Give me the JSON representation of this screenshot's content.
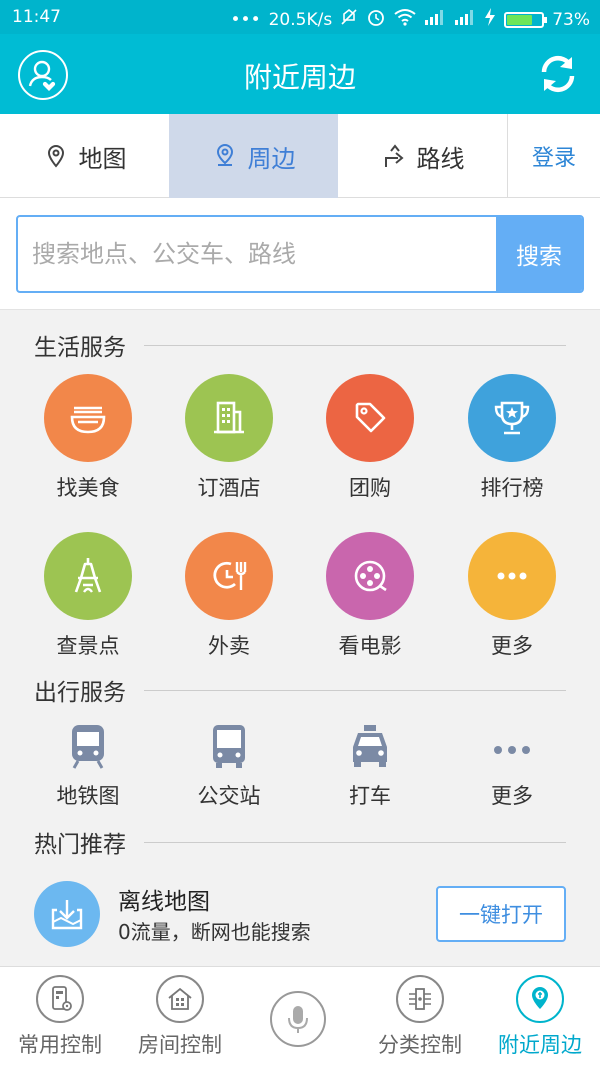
{
  "status_bar": {
    "time": "11:47",
    "network_speed": "20.5K/s",
    "battery_level": "73%",
    "battery_fraction": 0.73
  },
  "header": {
    "title": "附近周边"
  },
  "tabs": [
    {
      "label": "地图",
      "icon": "map-pin-icon"
    },
    {
      "label": "周边",
      "icon": "location-icon",
      "active": true
    },
    {
      "label": "路线",
      "icon": "route-icon"
    }
  ],
  "login_label": "登录",
  "search": {
    "placeholder": "搜索地点、公交车、路线",
    "value": "",
    "button_label": "搜索"
  },
  "life_services": {
    "title": "生活服务",
    "items": [
      {
        "label": "找美食",
        "icon": "food-bowl-icon",
        "color": "#f2874a"
      },
      {
        "label": "订酒店",
        "icon": "hotel-icon",
        "color": "#9dc452"
      },
      {
        "label": "团购",
        "icon": "tag-icon",
        "color": "#ec6543"
      },
      {
        "label": "排行榜",
        "icon": "trophy-icon",
        "color": "#3fa2dc"
      },
      {
        "label": "查景点",
        "icon": "eiffel-tower-icon",
        "color": "#9dc452"
      },
      {
        "label": "外卖",
        "icon": "takeout-clock-fork-icon",
        "color": "#f2874a"
      },
      {
        "label": "看电影",
        "icon": "film-reel-icon",
        "color": "#c966ad"
      },
      {
        "label": "更多",
        "icon": "more-dots-icon",
        "color": "#f5b43a"
      }
    ]
  },
  "travel_services": {
    "title": "出行服务",
    "items": [
      {
        "label": "地铁图",
        "icon": "subway-icon"
      },
      {
        "label": "公交站",
        "icon": "bus-icon"
      },
      {
        "label": "打车",
        "icon": "taxi-icon"
      },
      {
        "label": "更多",
        "icon": "more-dots-icon"
      }
    ]
  },
  "hot_recommend": {
    "title": "热门推荐",
    "offline_map": {
      "title": "离线地图",
      "desc": "0流量，断网也能搜索",
      "button_label": "一键打开",
      "icon": "download-map-icon"
    }
  },
  "bottom_nav": [
    {
      "label": "常用控制",
      "icon": "phone-settings-icon"
    },
    {
      "label": "房间控制",
      "icon": "house-icon"
    },
    {
      "label": "分类控制",
      "icon": "category-icon"
    },
    {
      "label": "附近周边",
      "icon": "nearby-pin-icon",
      "active": true
    }
  ],
  "colors": {
    "primary": "#00bcd4",
    "accent_blue": "#64aef5",
    "active_tab_bg": "#cfd9ea"
  }
}
